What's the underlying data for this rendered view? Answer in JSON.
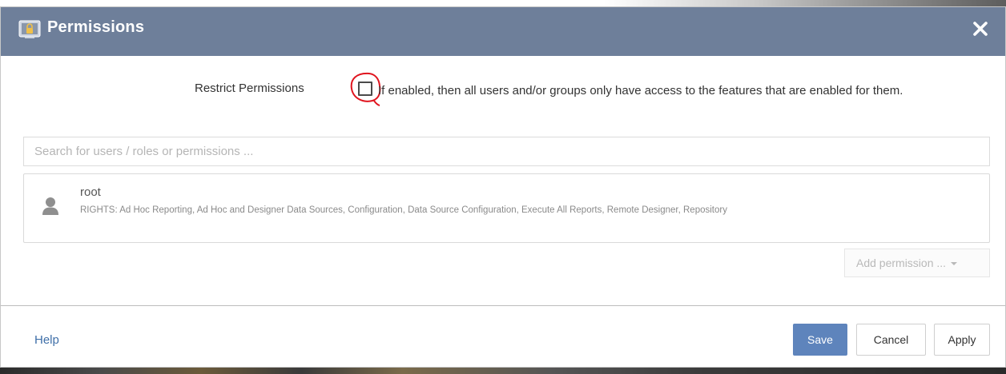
{
  "dialog": {
    "title": "Permissions",
    "title_icon": "lock-icon",
    "close_icon": "close-icon",
    "header_color": "#6e7f9a"
  },
  "restrict": {
    "label": "Restrict Permissions",
    "checked": false,
    "description": "If enabled, then all users and/or groups only have access to the features that are enabled for them."
  },
  "search": {
    "value": "",
    "placeholder": "Search for users / roles or permissions ..."
  },
  "permissions": [
    {
      "name": "root",
      "icon": "user-icon",
      "rights": "RIGHTS: Ad Hoc Reporting, Ad Hoc and Designer Data Sources, Configuration, Data Source Configuration, Execute All Reports, Remote Designer, Repository"
    }
  ],
  "add_permission": {
    "label": "Add permission ..."
  },
  "footer": {
    "help_label": "Help",
    "save_label": "Save",
    "cancel_label": "Cancel",
    "apply_label": "Apply",
    "accent_color": "#5e84bc",
    "link_color": "#3f6fa8"
  }
}
